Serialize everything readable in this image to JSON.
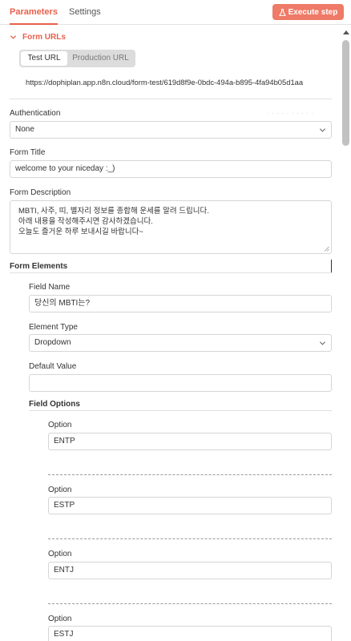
{
  "tabs": [
    {
      "label": "Parameters",
      "active": true
    },
    {
      "label": "Settings",
      "active": false
    }
  ],
  "execute_button": {
    "label": "Execute step",
    "icon": "flask-icon"
  },
  "form_urls": {
    "title": "Form URLs",
    "toggle": [
      "Test URL",
      "Production URL"
    ],
    "selected": "Test URL",
    "url": "https://dophiplan.app.n8n.cloud/form-test/619d8f9e-0bdc-494a-b895-4fa94b05d1aa"
  },
  "authentication": {
    "label": "Authentication",
    "value": "None"
  },
  "form_title": {
    "label": "Form Title",
    "value": "welcome to your niceday :_)"
  },
  "form_description": {
    "label": "Form Description",
    "lines": [
      "MBTI, 사주, 띠, 별자리 정보를 종합해 운세를 알려 드립니다.",
      "아래 내용을 작성해주시면 감사하겠습니다.",
      "오늘도 즐거운 하루 보내시길 바랍니다~"
    ]
  },
  "form_elements": {
    "label": "Form Elements",
    "field_name": {
      "label": "Field Name",
      "value": "당신의 MBTI는?"
    },
    "element_type": {
      "label": "Element Type",
      "value": "Dropdown"
    },
    "default_value": {
      "label": "Default Value",
      "value": ""
    },
    "field_options": {
      "label": "Field Options",
      "options": [
        {
          "label": "Option",
          "value": "ENTP"
        },
        {
          "label": "Option",
          "value": "ESTP"
        },
        {
          "label": "Option",
          "value": "ENTJ"
        },
        {
          "label": "Option",
          "value": "ESTJ"
        }
      ]
    }
  },
  "colors": {
    "accent": "#e8604c",
    "button": "#ef7a67"
  }
}
